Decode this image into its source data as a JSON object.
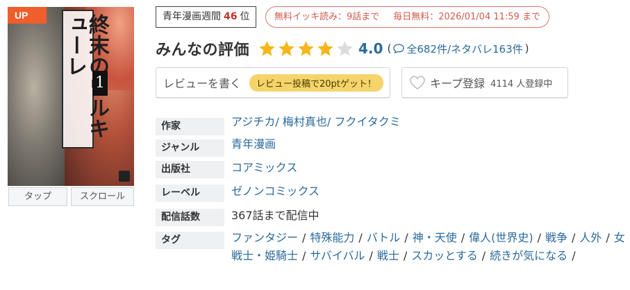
{
  "cover": {
    "badge": "UP",
    "title_vertical": "終末のワルキューレ",
    "volume": "1",
    "buttons": {
      "tap": "タップ",
      "scroll": "スクロール"
    }
  },
  "ranking": {
    "prefix": "青年漫画週間",
    "rank": "46",
    "suffix": "位"
  },
  "free_info": {
    "ikki": "無料イッキ読み：9話まで",
    "daily": "毎日無料：2026/01/04 11:59 まで"
  },
  "rating": {
    "heading": "みんなの評価",
    "score": "4.0",
    "stars_filled": 4,
    "stars_total": 5,
    "open_paren": "(",
    "counts": "全682件/ネタバレ163件",
    "close_paren": ")"
  },
  "actions": {
    "review_label": "レビューを書く",
    "review_pill": "レビュー投稿で20ptゲット！",
    "keep_label": "キープ登録",
    "keep_count": "4114 人登録中"
  },
  "info": {
    "author_label": "作家",
    "authors": [
      "アジチカ",
      "梅村真也",
      "フクイタクミ"
    ],
    "genre_label": "ジャンル",
    "genre": "青年漫画",
    "publisher_label": "出版社",
    "publisher": "コアミックス",
    "label_label": "レーベル",
    "label": "ゼノンコミックス",
    "episodes_label": "配信話数",
    "episodes": "367話まで配信中",
    "tags_label": "タグ",
    "tags": [
      "ファンタジー",
      "特殊能力",
      "バトル",
      "神・天使",
      "偉人(世界史)",
      "戦争",
      "人外",
      "女戦士・姫騎士",
      "サバイバル",
      "戦士",
      "スカッとする",
      "続きが気になる"
    ]
  },
  "colors": {
    "accent_blue": "#2a6a9c",
    "star_gold": "#f4b71b",
    "up_orange": "#ef5e2b",
    "pill_yellow": "#f5d46b",
    "free_red": "#d25a4e"
  }
}
